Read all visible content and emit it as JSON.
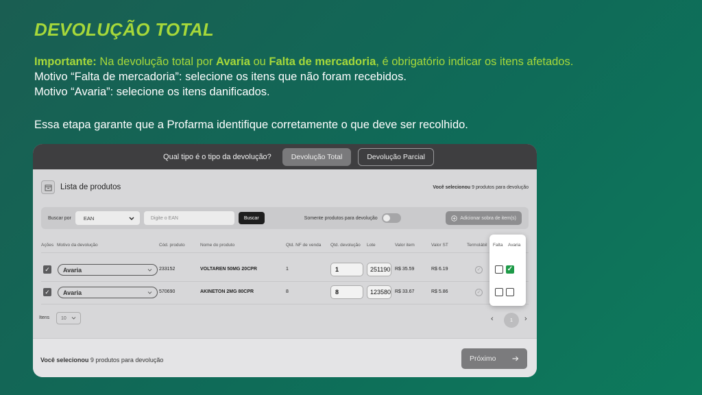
{
  "slide": {
    "title": "DEVOLUÇÃO TOTAL",
    "intro": {
      "important_label": "Importante:",
      "text1": " Na devolução total por ",
      "bold1": "Avaria",
      "text2": " ou ",
      "bold2": "Falta de mercadoria",
      "text3": ", é obrigatório indicar os itens afetados.",
      "line2": "Motivo “Falta de mercadoria”: selecione os itens que não foram recebidos.",
      "line3": "Motivo “Avaria”: selecione os itens danificados."
    },
    "closing": "Essa etapa garante que a Profarma identifique corretamente o que deve ser recolhido."
  },
  "topbar": {
    "question": "Qual tipo é o tipo da devolução?",
    "btn_total": "Devolução Total",
    "btn_parcial": "Devolução Parcial"
  },
  "list": {
    "title": "Lista de produtos",
    "selected_prefix": "Você selecionou",
    "selected_suffix": " 9 produtos para devolução"
  },
  "filter": {
    "search_by_label": "Buscar por",
    "search_by_value": "EAN",
    "input_placeholder": "Digite o EAN",
    "search_button": "Buscar",
    "only_label": "Somente produtos para devolução",
    "add_button": "Adicionar sobra de item(s)"
  },
  "columns": {
    "acoes": "Ações",
    "motivo": "Motivo da devolução",
    "cod": "Cód. produto",
    "nome": "Nome do produto",
    "qtd_nf": "Qtd. NF de venda",
    "qtd_dev": "Qtd. devolução",
    "lote": "Lote",
    "valor_item": "Valor item",
    "valor_st": "Valor ST",
    "termolabil": "Termolábil",
    "falta": "Falta",
    "avaria": "Avaria"
  },
  "rows": [
    {
      "motivo": "Avaria",
      "cod": "233152",
      "nome": "VOLTAREN 50MG 20CPR",
      "qtd_nf": "1",
      "qtd_dev": "1",
      "lote": "251190",
      "valor_item": "R$ 35.59",
      "valor_st": "R$ 6.19",
      "falta": false,
      "avaria": true
    },
    {
      "motivo": "Avaria",
      "cod": "570690",
      "nome": "AKINETON 2MG 80CPR",
      "qtd_nf": "8",
      "qtd_dev": "8",
      "lote": "123580",
      "valor_item": "R$ 33.67",
      "valor_st": "R$ 5.86",
      "falta": false,
      "avaria": false
    }
  ],
  "pagination": {
    "items_label": "Itens",
    "items_value": "10",
    "current_page": "1"
  },
  "footer": {
    "selected_prefix": "Você selecionou",
    "selected_suffix": " 9 produtos para devolução",
    "next_button": "Próximo"
  },
  "colors": {
    "accent_green": "#a6d83a",
    "check_green": "#1e9a48"
  }
}
